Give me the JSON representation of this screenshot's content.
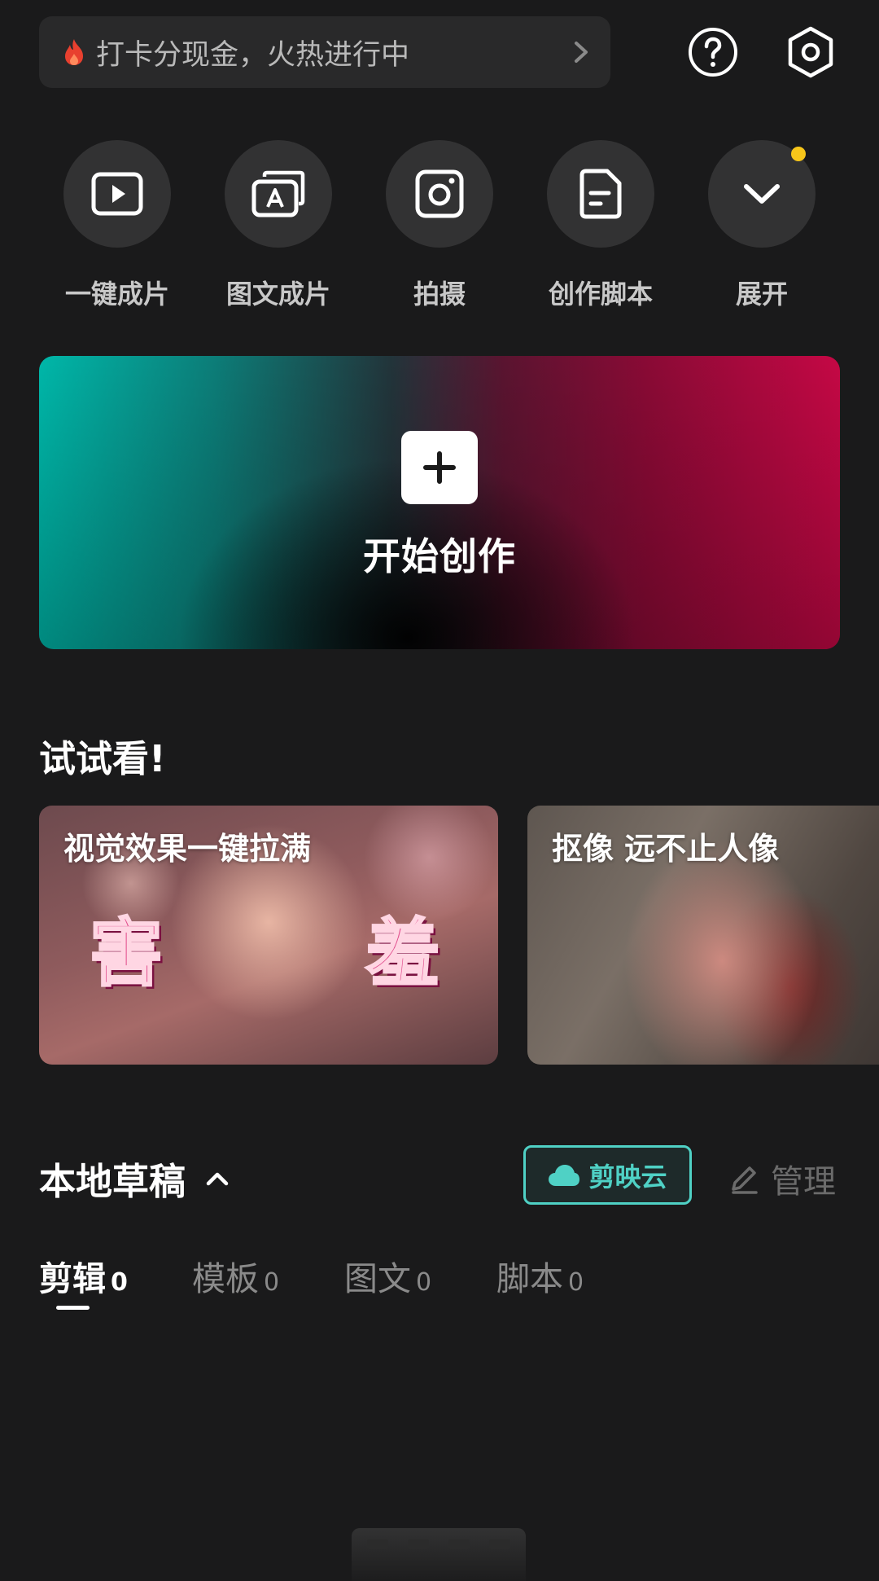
{
  "promo": {
    "text": "打卡分现金，火热进行中"
  },
  "quick_actions": [
    {
      "label": "一键成片",
      "icon": "play-icon"
    },
    {
      "label": "图文成片",
      "icon": "image-text-icon"
    },
    {
      "label": "拍摄",
      "icon": "camera-icon"
    },
    {
      "label": "创作脚本",
      "icon": "script-doc-icon"
    },
    {
      "label": "展开",
      "icon": "chevron-down-icon"
    }
  ],
  "create": {
    "label": "开始创作"
  },
  "try_section": {
    "title": "试试看!",
    "cards": [
      {
        "title": "视觉效果一键拉满",
        "deco_left": "害",
        "deco_right": "羞"
      },
      {
        "title": "抠像 远不止人像"
      }
    ]
  },
  "drafts": {
    "title": "本地草稿",
    "cloud_label": "剪映云",
    "manage_label": "管理",
    "tabs": [
      {
        "label": "剪辑",
        "count": "0"
      },
      {
        "label": "模板",
        "count": "0"
      },
      {
        "label": "图文",
        "count": "0"
      },
      {
        "label": "脚本",
        "count": "0"
      }
    ]
  },
  "colors": {
    "background": "#1a1a1b",
    "accent_teal": "#4fd1c5",
    "notification_dot": "#f7c61a"
  }
}
